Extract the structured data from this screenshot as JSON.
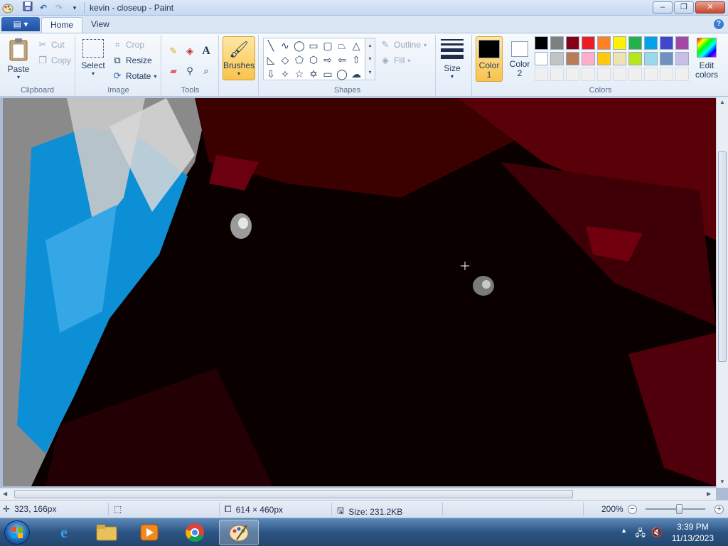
{
  "window": {
    "title": "kevin - closeup - Paint",
    "minimize": "–",
    "restore": "❐",
    "close": "✕"
  },
  "tabs": {
    "file": "▤ ▾",
    "items": [
      "Home",
      "View"
    ],
    "help": "?"
  },
  "ribbon": {
    "clipboard": {
      "label": "Clipboard",
      "paste": "Paste",
      "cut": "Cut",
      "copy": "Copy"
    },
    "image": {
      "label": "Image",
      "select": "Select",
      "crop": "Crop",
      "resize": "Resize",
      "rotate": "Rotate"
    },
    "tools": {
      "label": "Tools"
    },
    "brushes": "Brushes",
    "shapes": {
      "label": "Shapes",
      "outline": "Outline",
      "fill": "Fill"
    },
    "size": "Size",
    "colors": {
      "label": "Colors",
      "color1": "Color\n1",
      "color1_line1": "Color",
      "color1_line2": "1",
      "color2_line1": "Color",
      "color2_line2": "2",
      "edit_line1": "Edit",
      "edit_line2": "colors",
      "color1_value": "#000000",
      "color2_value": "#ffffff",
      "palette_row1": [
        "#000000",
        "#7f7f7f",
        "#880015",
        "#ed1c24",
        "#ff7f27",
        "#fff200",
        "#22b14c",
        "#00a2e8",
        "#3f48cc",
        "#a349a4"
      ],
      "palette_row2": [
        "#ffffff",
        "#c3c3c3",
        "#b97a57",
        "#ffaec9",
        "#ffc90e",
        "#efe4b0",
        "#b5e61d",
        "#99d9ea",
        "#7092be",
        "#c8bfe7"
      ],
      "palette_row3": [
        "#f0f0f0",
        "#f0f0f0",
        "#f0f0f0",
        "#f0f0f0",
        "#f0f0f0",
        "#f0f0f0",
        "#f0f0f0",
        "#f0f0f0",
        "#f0f0f0",
        "#f0f0f0"
      ]
    }
  },
  "status": {
    "cursor_pos": "323, 166px",
    "dimensions": "614 × 460px",
    "file_size": "Size: 231.2KB",
    "zoom": "200%"
  },
  "taskbar": {
    "time": "3:39 PM",
    "date": "11/13/2023"
  }
}
